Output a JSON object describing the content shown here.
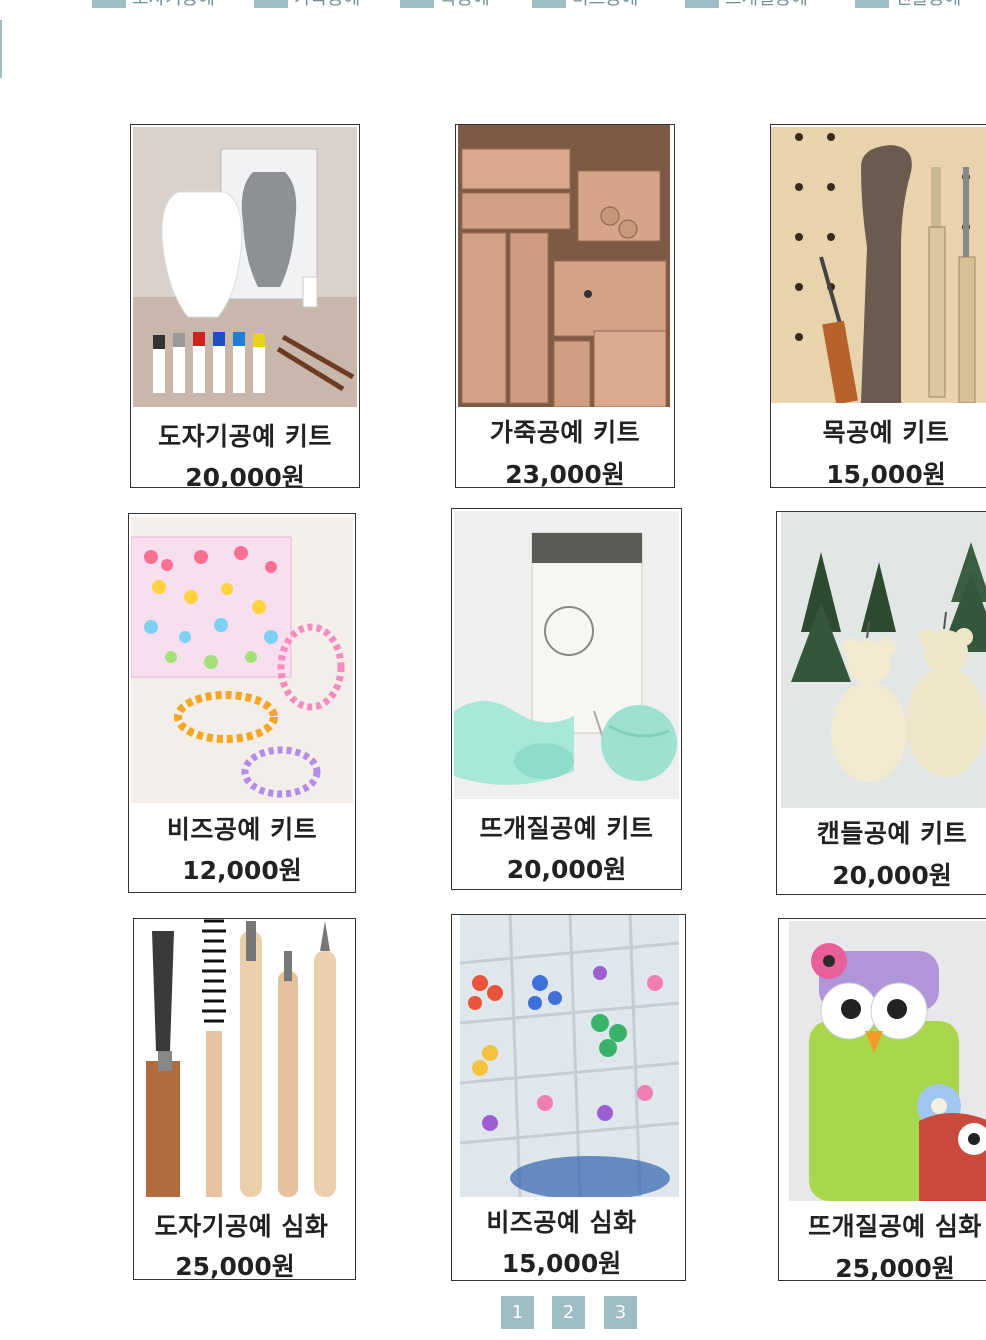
{
  "nav": {
    "categories": [
      "도자기공예",
      "가죽공예",
      "목공예",
      "비즈공예",
      "뜨개질공예",
      "캔들공예"
    ]
  },
  "products": [
    {
      "name": "도자기공예 키트",
      "price": "20,000원",
      "image": "ceramic-kit-image"
    },
    {
      "name": "가죽공예 키트",
      "price": "23,000원",
      "image": "leather-kit-image"
    },
    {
      "name": "목공예 키트",
      "price": "15,000원",
      "image": "wood-kit-image"
    },
    {
      "name": "비즈공예 키트",
      "price": "12,000원",
      "image": "beads-kit-image"
    },
    {
      "name": "뜨개질공예 키트",
      "price": "20,000원",
      "image": "knitting-kit-image"
    },
    {
      "name": "캔들공예 키트",
      "price": "20,000원",
      "image": "candle-kit-image"
    },
    {
      "name": "도자기공예 심화",
      "price": "25,000원",
      "image": "ceramic-tools-image"
    },
    {
      "name": "비즈공예 심화",
      "price": "15,000원",
      "image": "beads-box-image"
    },
    {
      "name": "뜨개질공예 심화",
      "price": "25,000원",
      "image": "knitted-owl-image"
    }
  ],
  "pagination": {
    "pages": [
      "1",
      "2",
      "3"
    ],
    "current": "1"
  },
  "colors": {
    "accent": "#9fbdc4"
  }
}
